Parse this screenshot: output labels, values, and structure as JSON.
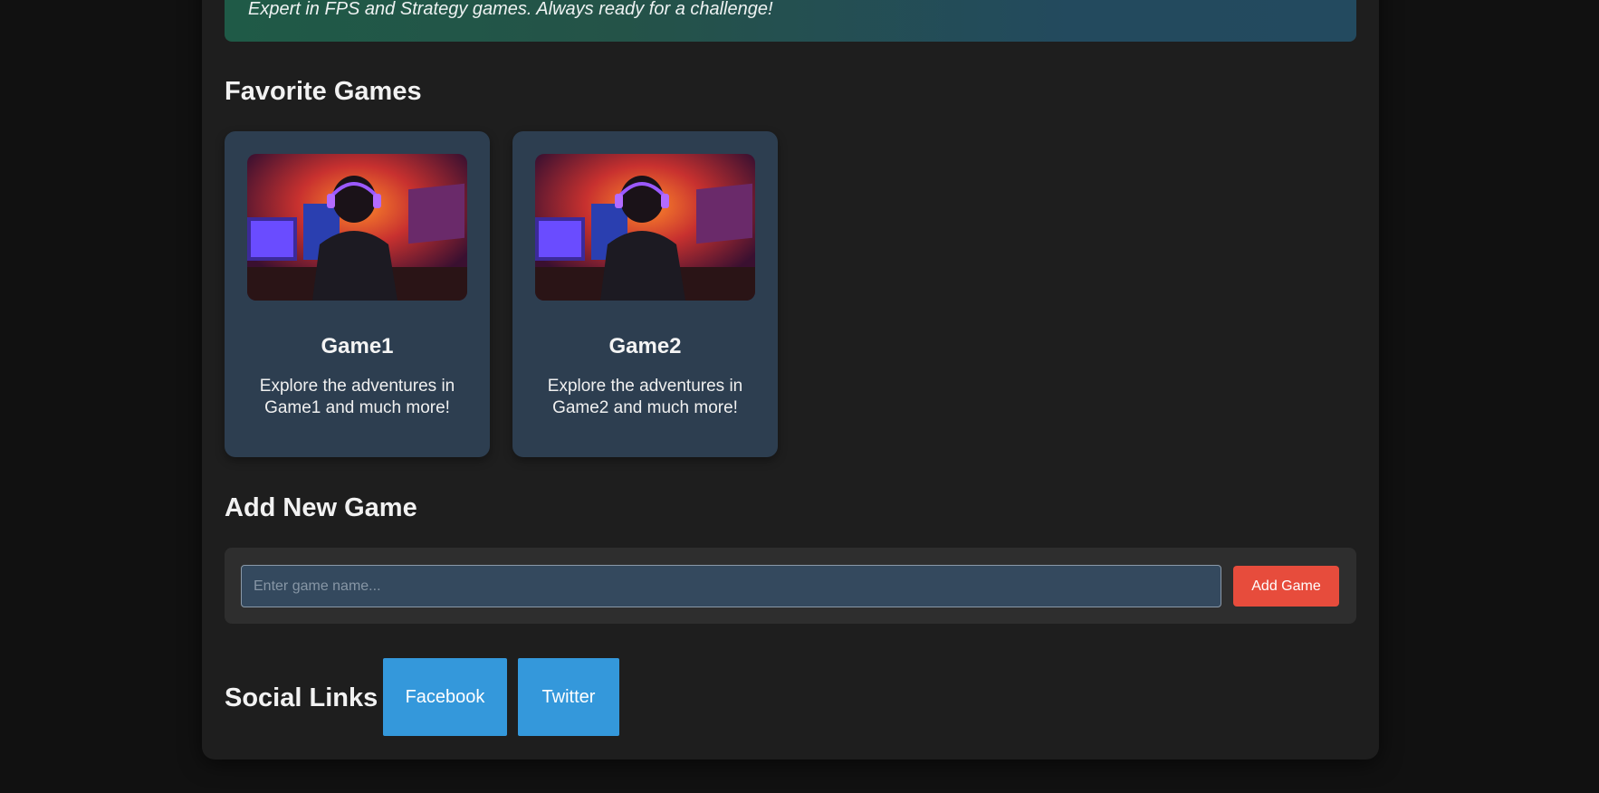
{
  "profile": {
    "bio": "Expert in FPS and Strategy games. Always ready for a challenge!"
  },
  "favorites": {
    "heading": "Favorite Games",
    "games": [
      {
        "title": "Game1",
        "description": "Explore the adventures in Game1 and much more!"
      },
      {
        "title": "Game2",
        "description": "Explore the adventures in Game2 and much more!"
      }
    ]
  },
  "add_game": {
    "heading": "Add New Game",
    "input_placeholder": "Enter game name...",
    "input_value": "",
    "button_label": "Add Game"
  },
  "social": {
    "heading": "Social Links",
    "links": [
      {
        "label": "Facebook"
      },
      {
        "label": "Twitter"
      }
    ]
  },
  "colors": {
    "page_bg": "#111111",
    "container_bg": "#1e1e1e",
    "card_bg": "#2d3e50",
    "input_bg": "#34495e",
    "add_button": "#e74c3c",
    "social_button": "#3498db"
  }
}
